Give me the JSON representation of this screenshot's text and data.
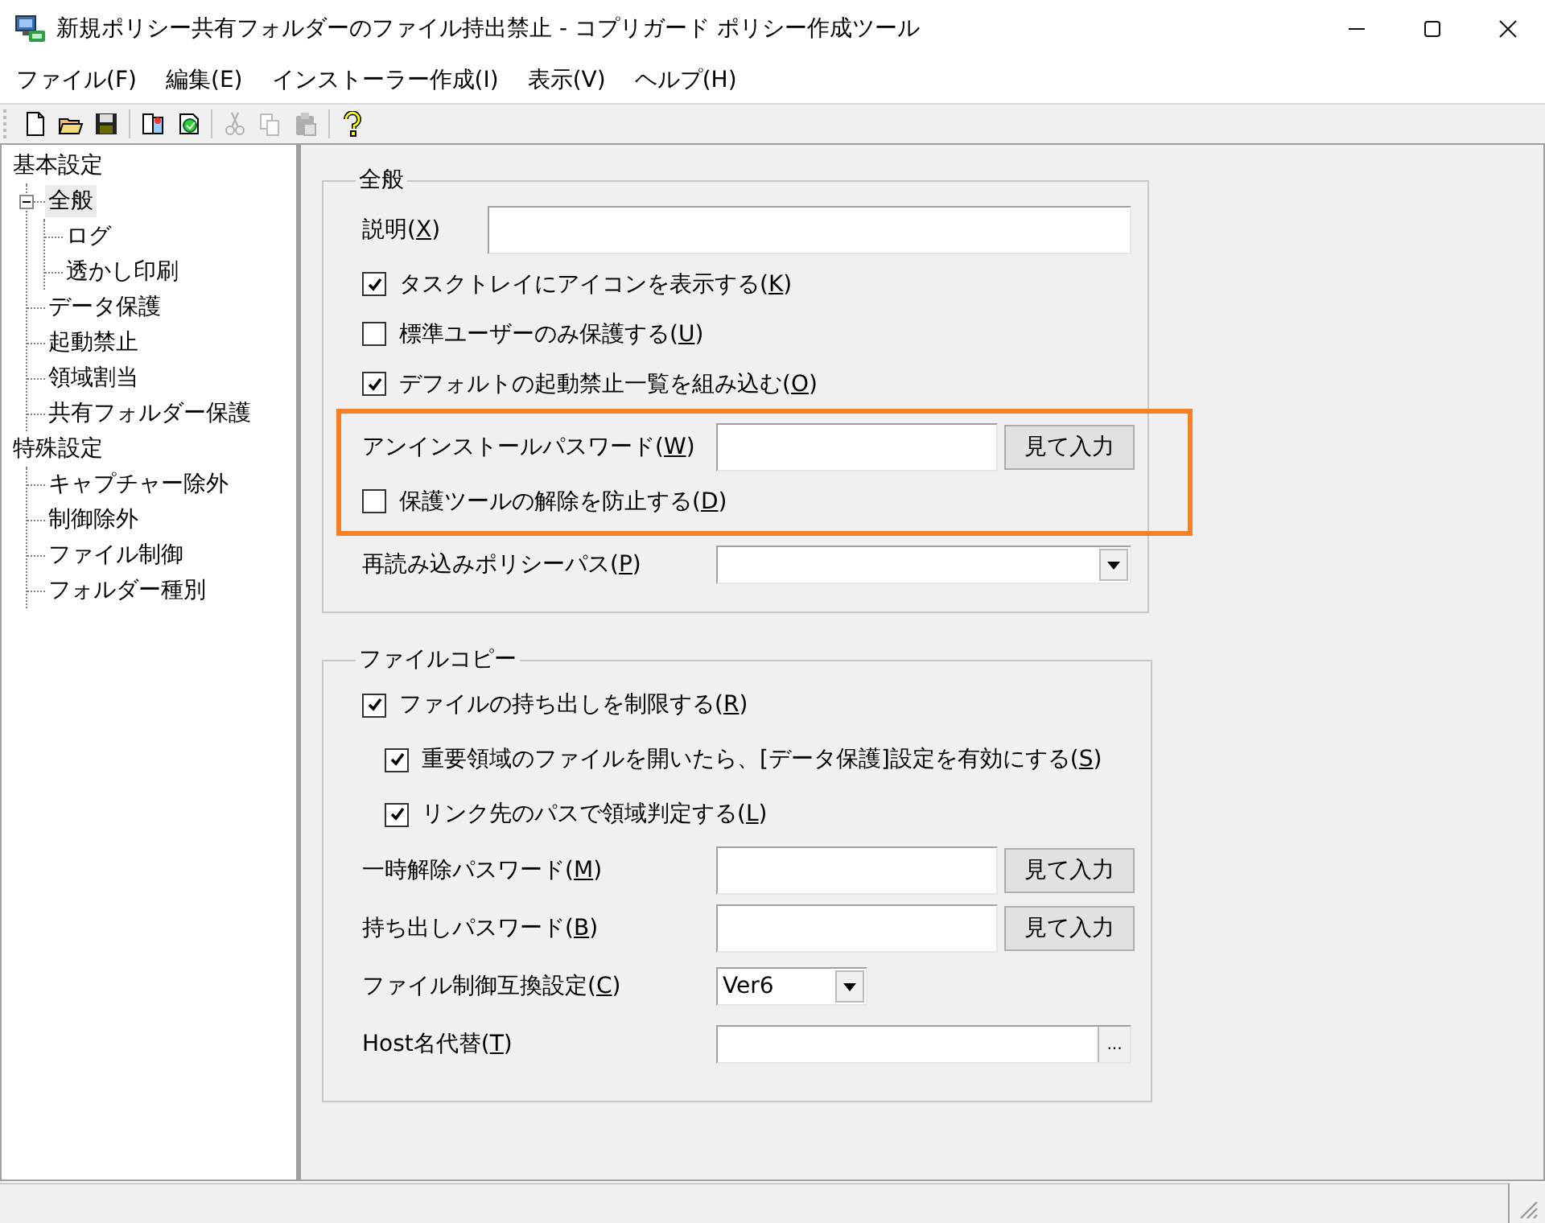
{
  "window": {
    "title": "新規ポリシー共有フォルダーのファイル持出禁止 - コプリガード ポリシー作成ツール"
  },
  "menu": [
    "ファイル(F)",
    "編集(E)",
    "インストーラー作成(I)",
    "表示(V)",
    "ヘルプ(H)"
  ],
  "toolbar": [
    {
      "kind": "new",
      "disabled": false
    },
    {
      "kind": "open",
      "disabled": false
    },
    {
      "kind": "save",
      "disabled": false
    },
    {
      "kind": "sep"
    },
    {
      "kind": "build",
      "disabled": false
    },
    {
      "kind": "build2",
      "disabled": false
    },
    {
      "kind": "sep"
    },
    {
      "kind": "cut",
      "disabled": true
    },
    {
      "kind": "copy",
      "disabled": true
    },
    {
      "kind": "paste",
      "disabled": true
    },
    {
      "kind": "sep"
    },
    {
      "kind": "help",
      "disabled": false
    }
  ],
  "sidebar": {
    "tree": [
      {
        "label": "基本設定",
        "selected": false,
        "children": [
          {
            "label": "全般",
            "selected": true,
            "expanded": true,
            "children": [
              {
                "label": "ログ",
                "selected": false
              },
              {
                "label": "透かし印刷",
                "selected": false
              }
            ]
          },
          {
            "label": "データ保護",
            "selected": false
          },
          {
            "label": "起動禁止",
            "selected": false
          },
          {
            "label": "領域割当",
            "selected": false
          },
          {
            "label": "共有フォルダー保護",
            "selected": false
          }
        ]
      },
      {
        "label": "特殊設定",
        "selected": false,
        "children": [
          {
            "label": "キャプチャー除外",
            "selected": false
          },
          {
            "label": "制御除外",
            "selected": false
          },
          {
            "label": "ファイル制御",
            "selected": false
          },
          {
            "label": "フォルダー種別",
            "selected": false
          }
        ]
      }
    ]
  },
  "groups": [
    {
      "title": "全般",
      "rows": [
        {
          "kind": "text",
          "label": "説明(",
          "key": "X",
          "label_end": ")"
        },
        {
          "kind": "checkbox",
          "label": "タスクトレイにアイコンを表示する(",
          "key": "K",
          "label_end": ")",
          "checked": true
        },
        {
          "kind": "checkbox",
          "label": "標準ユーザーのみ保護する(",
          "key": "U",
          "label_end": ")",
          "checked": false
        },
        {
          "kind": "checkbox",
          "label": "デフォルトの起動禁止一覧を組み込む(",
          "key": "O",
          "label_end": ")",
          "checked": true
        },
        {
          "kind": "highlight",
          "rows": [
            {
              "kind": "password",
              "label": "アンインストールパスワード(",
              "key": "W",
              "label_end": ")",
              "button": "見て入力"
            },
            {
              "kind": "checkbox",
              "label": "保護ツールの解除を防止する(",
              "key": "D",
              "label_end": ")",
              "checked": false
            }
          ]
        },
        {
          "kind": "dropdown",
          "label": "再読み込みポリシーパス(",
          "key": "P",
          "label_end": ")"
        }
      ]
    },
    {
      "title": "ファイルコピー",
      "rows": [
        {
          "kind": "checkbox",
          "label": "ファイルの持ち出しを制限する(",
          "key": "R",
          "label_end": ")",
          "checked": true,
          "children": [
            {
              "kind": "checkbox",
              "label": "重要領域のファイルを開いたら、[データ保護]設定を有効にする(",
              "key": "S",
              "label_end": ")",
              "checked": true
            },
            {
              "kind": "checkbox",
              "label": "リンク先のパスで領域判定する(",
              "key": "L",
              "label_end": ")",
              "checked": true
            }
          ]
        },
        {
          "kind": "password",
          "label": "一時解除パスワード(",
          "key": "M",
          "label_end": ")",
          "button": "見て入力"
        },
        {
          "kind": "password",
          "label": "持ち出しパスワード(",
          "key": "B",
          "label_end": ")",
          "button": "見て入力"
        },
        {
          "kind": "select",
          "label": "ファイル制御互換設定(",
          "key": "C",
          "label_end": ")",
          "value": "Ver6"
        },
        {
          "kind": "browse",
          "label": "Host名代替(",
          "key": "T",
          "label_end": ")",
          "button": "..."
        }
      ]
    }
  ]
}
